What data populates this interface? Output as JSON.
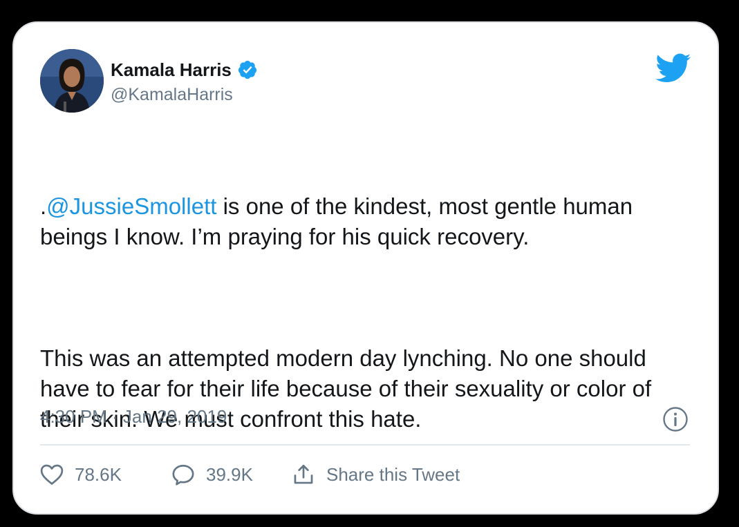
{
  "author": {
    "display_name": "Kamala Harris",
    "handle": "@KamalaHarris",
    "verified": true,
    "verified_icon": "verified-badge-icon",
    "avatar_icon": "profile-photo"
  },
  "brand": {
    "icon": "twitter-bird-icon",
    "color": "#1da1f2"
  },
  "tweet": {
    "mention": "@JussieSmollett",
    "mention_prefix": ".",
    "paragraph1_rest": " is one of the kindest, most gentle human beings I know. I’m praying for his quick recovery.",
    "paragraph2": "This was an attempted modern day lynching. No one should have to fear for their life because of their sexuality or color of their skin. We must confront this hate.",
    "mention_color": "#1b95e0"
  },
  "meta": {
    "timestamp": "4:30 PM · Jan 29, 2019",
    "info_icon": "info-icon"
  },
  "actions": {
    "like": {
      "icon": "heart-icon",
      "count": "78.6K"
    },
    "reply": {
      "icon": "speech-bubble-icon",
      "count": "39.9K"
    },
    "share": {
      "icon": "share-icon",
      "label": "Share this Tweet"
    }
  }
}
